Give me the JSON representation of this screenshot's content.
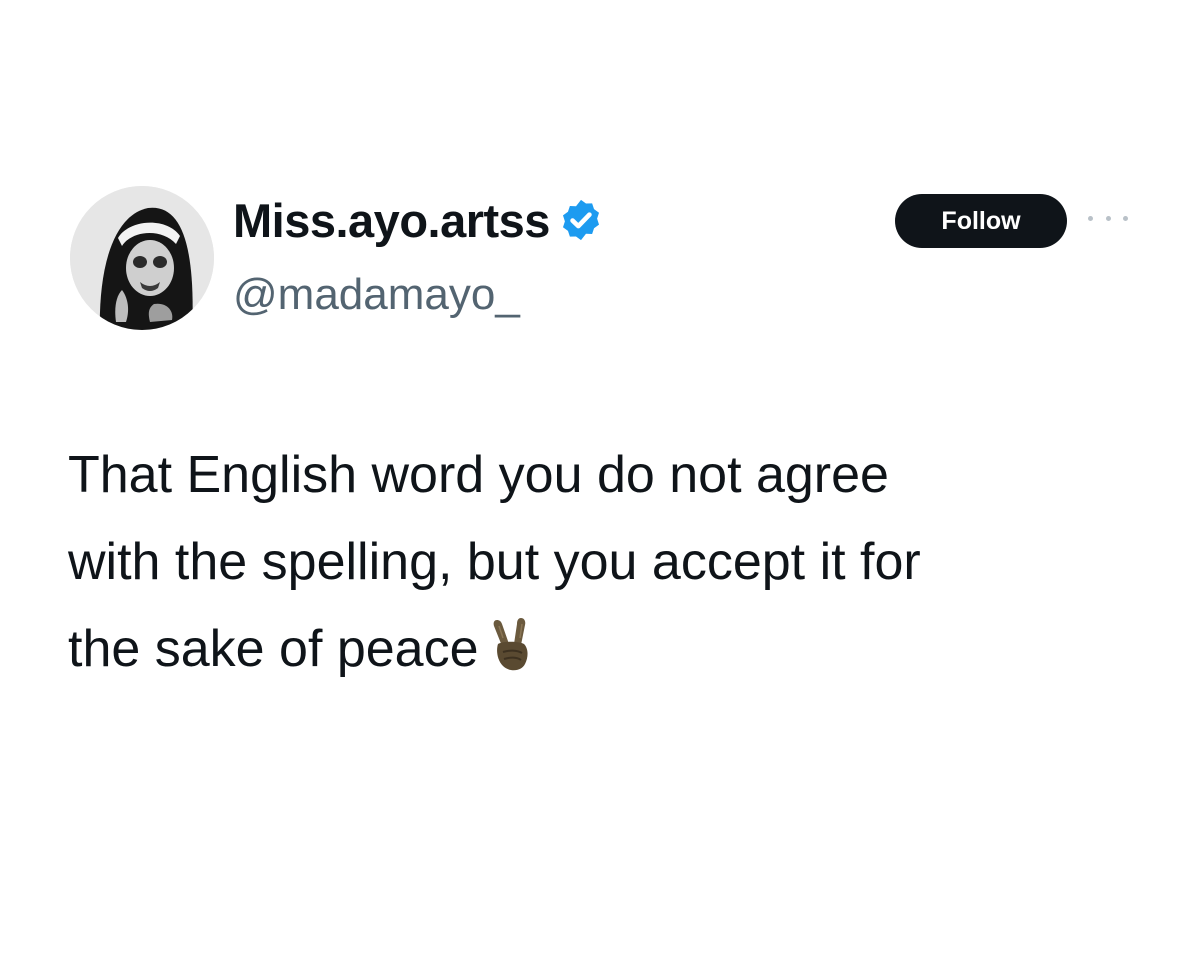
{
  "author": {
    "display_name": "Miss.ayo.artss",
    "handle": "@madamayo_",
    "verified": true,
    "verified_color": "#1d9bf0",
    "avatar_icon": "avatar-portrait-icon"
  },
  "actions": {
    "follow_label": "Follow",
    "more_icon": "more-options-icon"
  },
  "tweet": {
    "text_lines": [
      "That English word you do not agree",
      "with the spelling, but you accept it for",
      "the sake of peace"
    ],
    "emoji": "victory-hand-icon"
  },
  "colors": {
    "text": "#0f1419",
    "secondary_text": "#536471",
    "button_bg": "#0f1419",
    "button_text": "#ffffff"
  }
}
